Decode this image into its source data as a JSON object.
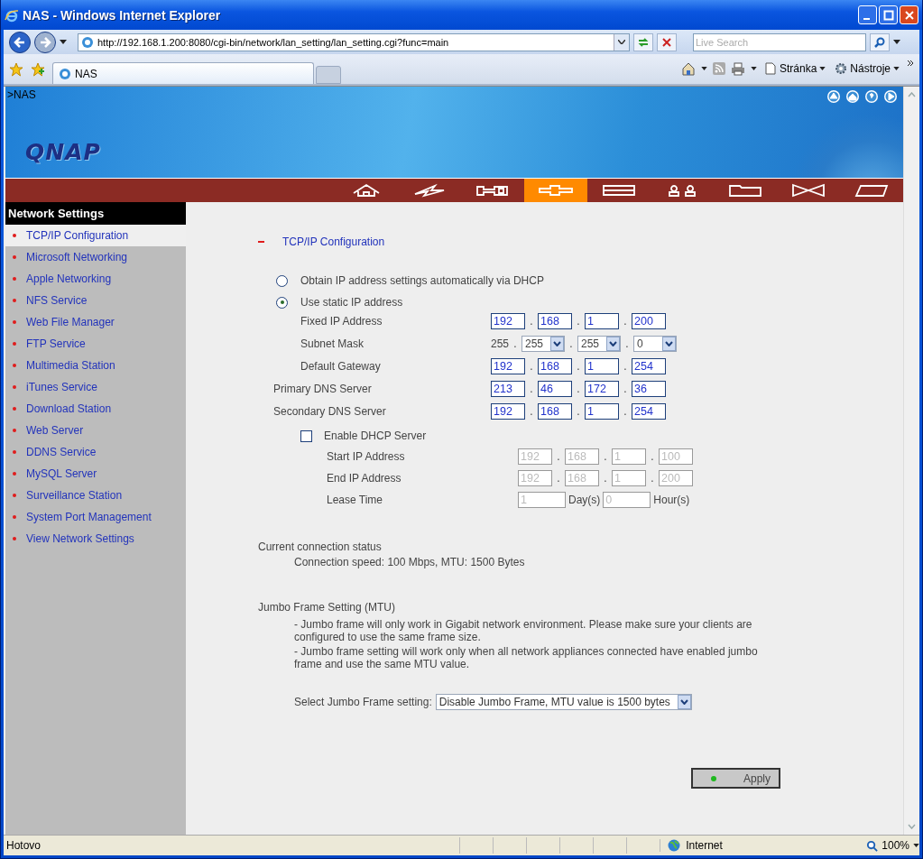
{
  "window": {
    "title": "NAS - Windows Internet Explorer"
  },
  "address_bar": {
    "url": "http://192.168.1.200:8080/cgi-bin/network/lan_setting/lan_setting.cgi?func=main"
  },
  "search": {
    "placeholder": "Live Search"
  },
  "tabs": [
    {
      "label": "NAS",
      "selected": true
    }
  ],
  "command_bar": [
    "Stránka",
    "Nástroje"
  ],
  "page": {
    "breadcrumb": ">NAS",
    "logo": "QNAP",
    "nav": [
      {
        "kind": "home",
        "selected": false
      },
      {
        "kind": "bolt",
        "selected": false
      },
      {
        "kind": "wrench",
        "selected": false
      },
      {
        "kind": "network",
        "selected": true
      },
      {
        "kind": "disk",
        "selected": false
      },
      {
        "kind": "users",
        "selected": false
      },
      {
        "kind": "folder",
        "selected": false
      },
      {
        "kind": "bowtie",
        "selected": false
      },
      {
        "kind": "note",
        "selected": false
      }
    ],
    "sidebar": {
      "title": "Network Settings",
      "items": [
        {
          "label": "TCP/IP Configuration",
          "selected": true
        },
        {
          "label": "Microsoft Networking",
          "selected": false
        },
        {
          "label": "Apple Networking",
          "selected": false
        },
        {
          "label": "NFS Service",
          "selected": false
        },
        {
          "label": "Web File Manager",
          "selected": false
        },
        {
          "label": "FTP Service",
          "selected": false
        },
        {
          "label": "Multimedia Station",
          "selected": false
        },
        {
          "label": "iTunes Service",
          "selected": false
        },
        {
          "label": "Download Station",
          "selected": false
        },
        {
          "label": "Web Server",
          "selected": false
        },
        {
          "label": "DDNS Service",
          "selected": false
        },
        {
          "label": "MySQL Server",
          "selected": false
        },
        {
          "label": "Surveillance Station",
          "selected": false
        },
        {
          "label": "System Port Management",
          "selected": false
        },
        {
          "label": "View Network Settings",
          "selected": false
        }
      ]
    },
    "section_title": "TCP/IP Configuration",
    "ip_modes": [
      {
        "label": "Obtain IP address settings automatically via DHCP",
        "selected": false
      },
      {
        "label": "Use static IP address",
        "selected": true
      }
    ],
    "static_rows": [
      {
        "kind": "ip",
        "label": "Fixed IP Address",
        "values": [
          "192",
          "168",
          "1",
          "200"
        ],
        "separators": [
          ".",
          ".",
          "."
        ]
      },
      {
        "kind": "mask",
        "label": "Subnet Mask",
        "prefix": "255",
        "values": [
          "255",
          "255",
          "0"
        ],
        "separators": [
          ".",
          ".",
          "."
        ]
      },
      {
        "kind": "ip",
        "label": "Default Gateway",
        "values": [
          "192",
          "168",
          "1",
          "254"
        ],
        "separators": [
          ".",
          ".",
          "."
        ]
      }
    ],
    "dns_rows": [
      {
        "label": "Primary DNS Server",
        "values": [
          "213",
          "46",
          "172",
          "36"
        ],
        "separators": [
          ".",
          ".",
          "."
        ]
      },
      {
        "label": "Secondary DNS Server",
        "values": [
          "192",
          "168",
          "1",
          "254"
        ],
        "separators": [
          ".",
          ".",
          "."
        ]
      }
    ],
    "dhcp_server": {
      "label": "Enable DHCP Server",
      "checked": false,
      "disabled": true,
      "rows": [
        {
          "label": "Start IP Address",
          "values": [
            "192",
            "168",
            "1",
            "100"
          ],
          "separators": [
            ".",
            ".",
            "."
          ]
        },
        {
          "label": "End IP Address",
          "values": [
            "192",
            "168",
            "1",
            "200"
          ],
          "separators": [
            ".",
            ".",
            "."
          ]
        }
      ],
      "lease": {
        "label": "Lease Time",
        "days": "1",
        "days_unit": "Day(s)",
        "hours": "0",
        "hours_unit": "Hour(s)"
      }
    },
    "status": {
      "heading": "Current connection status",
      "text": "Connection speed: 100 Mbps, MTU: 1500 Bytes"
    },
    "jumbo": {
      "heading": "Jumbo Frame Setting (MTU)",
      "notes": [
        "- Jumbo frame will only work in Gigabit network environment. Please make sure your clients are configured to use the same frame size.",
        "- Jumbo frame setting will work only when all network appliances connected have enabled jumbo frame and use the same MTU value."
      ],
      "select_label": "Select Jumbo Frame setting:",
      "select_value": "Disable Jumbo Frame, MTU value is 1500 bytes"
    },
    "apply": "Apply"
  },
  "status_bar": {
    "text": "Hotovo",
    "zone": "Internet",
    "zoom": "100%"
  }
}
